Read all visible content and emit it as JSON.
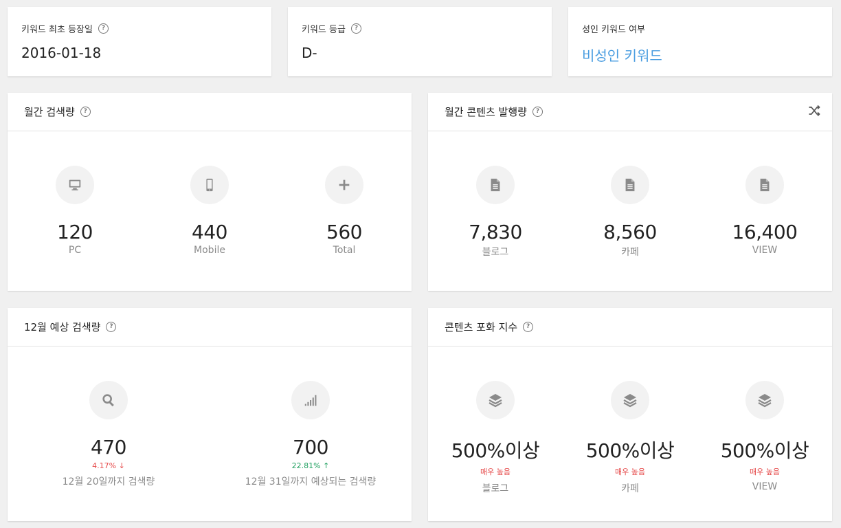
{
  "info": {
    "first_seen": {
      "label": "키워드 최초 등장일",
      "value": "2016-01-18"
    },
    "grade": {
      "label": "키워드 등급",
      "value": "D-"
    },
    "adult": {
      "label": "성인 키워드 여부",
      "value": "비성인 키워드"
    }
  },
  "help_glyph": "?",
  "monthly_search": {
    "title": "월간 검색량",
    "items": [
      {
        "icon": "monitor-icon",
        "value": "120",
        "label": "PC"
      },
      {
        "icon": "mobile-icon",
        "value": "440",
        "label": "Mobile"
      },
      {
        "icon": "plus-icon",
        "value": "560",
        "label": "Total"
      }
    ]
  },
  "monthly_content": {
    "title": "월간 콘텐츠 발행량",
    "items": [
      {
        "icon": "document-icon",
        "value": "7,830",
        "label": "블로그"
      },
      {
        "icon": "document-icon",
        "value": "8,560",
        "label": "카페"
      },
      {
        "icon": "document-icon",
        "value": "16,400",
        "label": "VIEW"
      }
    ]
  },
  "forecast": {
    "title": "12월 예상 검색량",
    "items": [
      {
        "icon": "search-icon",
        "value": "470",
        "change": "4.17%",
        "direction": "down",
        "label": "12월 20일까지 검색량"
      },
      {
        "icon": "signal-bars-icon",
        "value": "700",
        "change": "22.81%",
        "direction": "up",
        "label": "12월 31일까지 예상되는 검색량"
      }
    ]
  },
  "saturation": {
    "title": "콘텐츠 포화 지수",
    "items": [
      {
        "icon": "layers-icon",
        "value": "500%이상",
        "level": "매우 높음",
        "label": "블로그"
      },
      {
        "icon": "layers-icon",
        "value": "500%이상",
        "level": "매우 높음",
        "label": "카페"
      },
      {
        "icon": "layers-icon",
        "value": "500%이상",
        "level": "매우 높음",
        "label": "VIEW"
      }
    ]
  },
  "colors": {
    "accent_link": "#4a9de0",
    "down": "#e64a4a",
    "up": "#20a060"
  }
}
